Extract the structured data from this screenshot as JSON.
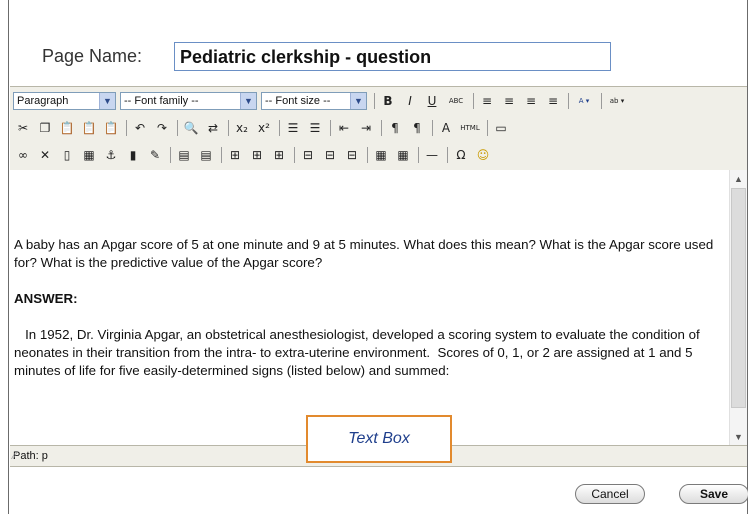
{
  "page_name": {
    "label": "Page Name:",
    "value": "Pediatric clerkship - question"
  },
  "toolbar": {
    "format_select": "Paragraph",
    "font_family_select": "-- Font family --",
    "font_size_select": "-- Font size --",
    "row1_buttons": [
      {
        "name": "bold-button",
        "glyph": "B"
      },
      {
        "name": "italic-button",
        "glyph": "I"
      },
      {
        "name": "underline-button",
        "glyph": "U"
      },
      {
        "name": "strikethrough-button",
        "glyph": "ABC"
      },
      {
        "name": "align-left-button",
        "glyph": "≡"
      },
      {
        "name": "align-center-button",
        "glyph": "≡"
      },
      {
        "name": "align-right-button",
        "glyph": "≡"
      },
      {
        "name": "justify-button",
        "glyph": "≡"
      },
      {
        "name": "font-color-button",
        "glyph": "A ▾"
      },
      {
        "name": "highlight-button",
        "glyph": "ab ▾"
      }
    ],
    "row2_buttons": [
      {
        "name": "cut-icon",
        "glyph": "✂"
      },
      {
        "name": "copy-icon",
        "glyph": "❐"
      },
      {
        "name": "paste-icon",
        "glyph": "📋"
      },
      {
        "name": "paste-text-icon",
        "glyph": "📋"
      },
      {
        "name": "paste-word-icon",
        "glyph": "📋"
      },
      {
        "name": "undo-icon",
        "glyph": "↶"
      },
      {
        "name": "redo-icon",
        "glyph": "↷"
      },
      {
        "name": "find-icon",
        "glyph": "🔍"
      },
      {
        "name": "replace-icon",
        "glyph": "⇄"
      },
      {
        "name": "subscript-button",
        "glyph": "x₂"
      },
      {
        "name": "superscript-button",
        "glyph": "x²"
      },
      {
        "name": "bullet-list-icon",
        "glyph": "☰"
      },
      {
        "name": "numbered-list-icon",
        "glyph": "☰"
      },
      {
        "name": "outdent-icon",
        "glyph": "⇤"
      },
      {
        "name": "indent-icon",
        "glyph": "⇥"
      },
      {
        "name": "ltr-icon",
        "glyph": "¶"
      },
      {
        "name": "rtl-icon",
        "glyph": "¶"
      },
      {
        "name": "styles-icon",
        "glyph": "A"
      },
      {
        "name": "html-button",
        "glyph": "HTML"
      },
      {
        "name": "fullscreen-icon",
        "glyph": "▭"
      }
    ],
    "row3_buttons": [
      {
        "name": "link-icon",
        "glyph": "∞"
      },
      {
        "name": "unlink-icon",
        "glyph": "✕"
      },
      {
        "name": "image-icon",
        "glyph": "▯"
      },
      {
        "name": "media-icon",
        "glyph": "▦"
      },
      {
        "name": "anchor-icon",
        "glyph": "⚓"
      },
      {
        "name": "file-icon",
        "glyph": "▮"
      },
      {
        "name": "edit-icon",
        "glyph": "✎"
      },
      {
        "name": "table-icon",
        "glyph": "▤"
      },
      {
        "name": "table-props-icon",
        "glyph": "▤"
      },
      {
        "name": "row-before-icon",
        "glyph": "⊞"
      },
      {
        "name": "row-after-icon",
        "glyph": "⊞"
      },
      {
        "name": "col-icon",
        "glyph": "⊞"
      },
      {
        "name": "merge-icon",
        "glyph": "⊟"
      },
      {
        "name": "split-icon",
        "glyph": "⊟"
      },
      {
        "name": "cell-icon",
        "glyph": "⊟"
      },
      {
        "name": "grid-icon",
        "glyph": "▦"
      },
      {
        "name": "grid2-icon",
        "glyph": "▦"
      },
      {
        "name": "hr-icon",
        "glyph": "—"
      },
      {
        "name": "omega-icon",
        "glyph": "Ω"
      },
      {
        "name": "smiley-icon",
        "glyph": "☺"
      }
    ]
  },
  "content": {
    "question": "A baby has an Apgar score of 5 at one minute and 9 at 5 minutes.  What does this mean?  What is the Apgar score used for?  What is the predictive value of the Apgar score?",
    "answer_heading": "ANSWER:",
    "answer_text": "   In 1952, Dr. Virginia Apgar, an obstetrical anesthesiologist, developed a scoring system to evaluate the condition of neonates in their transition from the intra- to extra-uterine environment.  Scores of 0, 1, or 2 are assigned at 1 and 5 minutes of life for five easily-determined signs (listed below) and summed:"
  },
  "path": "Path: p",
  "callout": "Text Box",
  "buttons": {
    "cancel": "Cancel",
    "save": "Save"
  }
}
